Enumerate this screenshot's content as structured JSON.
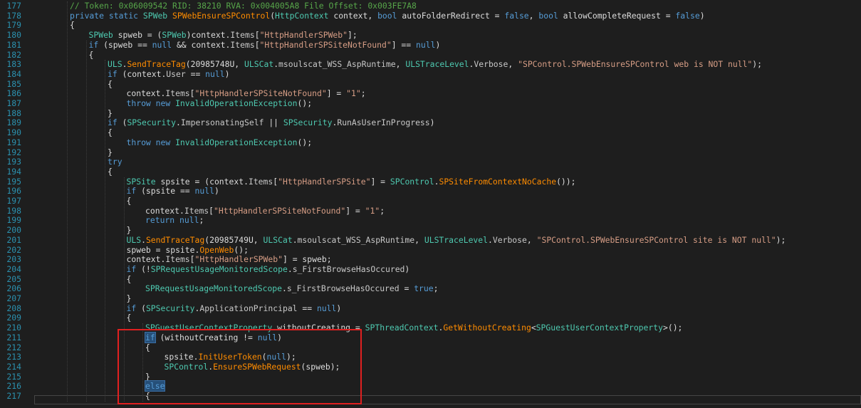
{
  "editor": {
    "lines": [
      {
        "n": "177",
        "indent": 2,
        "tokens": [
          {
            "c": "c",
            "t": "// Token: 0x06009542 RID: 38210 RVA: 0x004005A8 File Offset: 0x003FE7A8"
          }
        ]
      },
      {
        "n": "178",
        "indent": 2,
        "tokens": [
          {
            "c": "k",
            "t": "private static "
          },
          {
            "c": "t",
            "t": "SPWeb "
          },
          {
            "c": "m",
            "t": "SPWebEnsureSPControl"
          },
          {
            "c": "n",
            "t": "("
          },
          {
            "c": "t",
            "t": "HttpContext"
          },
          {
            "c": "n",
            "t": " context, "
          },
          {
            "c": "k",
            "t": "bool"
          },
          {
            "c": "n",
            "t": " autoFolderRedirect = "
          },
          {
            "c": "k",
            "t": "false"
          },
          {
            "c": "n",
            "t": ", "
          },
          {
            "c": "k",
            "t": "bool"
          },
          {
            "c": "n",
            "t": " allowCompleteRequest = "
          },
          {
            "c": "k",
            "t": "false"
          },
          {
            "c": "n",
            "t": ")"
          }
        ]
      },
      {
        "n": "179",
        "indent": 2,
        "tokens": [
          {
            "c": "n",
            "t": "{"
          }
        ]
      },
      {
        "n": "180",
        "indent": 3,
        "tokens": [
          {
            "c": "t",
            "t": "SPWeb"
          },
          {
            "c": "n",
            "t": " spweb = ("
          },
          {
            "c": "t",
            "t": "SPWeb"
          },
          {
            "c": "n",
            "t": ")context."
          },
          {
            "c": "p",
            "t": "Items"
          },
          {
            "c": "n",
            "t": "["
          },
          {
            "c": "s",
            "t": "\"HttpHandlerSPWeb\""
          },
          {
            "c": "n",
            "t": "];"
          }
        ]
      },
      {
        "n": "181",
        "indent": 3,
        "tokens": [
          {
            "c": "k",
            "t": "if"
          },
          {
            "c": "n",
            "t": " (spweb == "
          },
          {
            "c": "k",
            "t": "null"
          },
          {
            "c": "n",
            "t": " && context."
          },
          {
            "c": "p",
            "t": "Items"
          },
          {
            "c": "n",
            "t": "["
          },
          {
            "c": "s",
            "t": "\"HttpHandlerSPSiteNotFound\""
          },
          {
            "c": "n",
            "t": "] == "
          },
          {
            "c": "k",
            "t": "null"
          },
          {
            "c": "n",
            "t": ")"
          }
        ]
      },
      {
        "n": "182",
        "indent": 3,
        "tokens": [
          {
            "c": "n",
            "t": "{"
          }
        ]
      },
      {
        "n": "183",
        "indent": 4,
        "tokens": [
          {
            "c": "t",
            "t": "ULS"
          },
          {
            "c": "n",
            "t": "."
          },
          {
            "c": "m",
            "t": "SendTraceTag"
          },
          {
            "c": "n",
            "t": "(20985748U, "
          },
          {
            "c": "t",
            "t": "ULSCat"
          },
          {
            "c": "n",
            "t": "."
          },
          {
            "c": "p",
            "t": "msoulscat_WSS_AspRuntime"
          },
          {
            "c": "n",
            "t": ", "
          },
          {
            "c": "t",
            "t": "ULSTraceLevel"
          },
          {
            "c": "n",
            "t": "."
          },
          {
            "c": "p",
            "t": "Verbose"
          },
          {
            "c": "n",
            "t": ", "
          },
          {
            "c": "s",
            "t": "\"SPControl.SPWebEnsureSPControl web is NOT null\""
          },
          {
            "c": "n",
            "t": ");"
          }
        ]
      },
      {
        "n": "184",
        "indent": 4,
        "tokens": [
          {
            "c": "k",
            "t": "if"
          },
          {
            "c": "n",
            "t": " (context."
          },
          {
            "c": "p",
            "t": "User"
          },
          {
            "c": "n",
            "t": " == "
          },
          {
            "c": "k",
            "t": "null"
          },
          {
            "c": "n",
            "t": ")"
          }
        ]
      },
      {
        "n": "185",
        "indent": 4,
        "tokens": [
          {
            "c": "n",
            "t": "{"
          }
        ]
      },
      {
        "n": "186",
        "indent": 5,
        "tokens": [
          {
            "c": "n",
            "t": "context."
          },
          {
            "c": "p",
            "t": "Items"
          },
          {
            "c": "n",
            "t": "["
          },
          {
            "c": "s",
            "t": "\"HttpHandlerSPSiteNotFound\""
          },
          {
            "c": "n",
            "t": "] = "
          },
          {
            "c": "s",
            "t": "\"1\""
          },
          {
            "c": "n",
            "t": ";"
          }
        ]
      },
      {
        "n": "187",
        "indent": 5,
        "tokens": [
          {
            "c": "k",
            "t": "throw new "
          },
          {
            "c": "t",
            "t": "InvalidOperationException"
          },
          {
            "c": "n",
            "t": "();"
          }
        ]
      },
      {
        "n": "188",
        "indent": 4,
        "tokens": [
          {
            "c": "n",
            "t": "}"
          }
        ]
      },
      {
        "n": "189",
        "indent": 4,
        "tokens": [
          {
            "c": "k",
            "t": "if"
          },
          {
            "c": "n",
            "t": " ("
          },
          {
            "c": "t",
            "t": "SPSecurity"
          },
          {
            "c": "n",
            "t": "."
          },
          {
            "c": "p",
            "t": "ImpersonatingSelf"
          },
          {
            "c": "n",
            "t": " || "
          },
          {
            "c": "t",
            "t": "SPSecurity"
          },
          {
            "c": "n",
            "t": "."
          },
          {
            "c": "p",
            "t": "RunAsUserInProgress"
          },
          {
            "c": "n",
            "t": ")"
          }
        ]
      },
      {
        "n": "190",
        "indent": 4,
        "tokens": [
          {
            "c": "n",
            "t": "{"
          }
        ]
      },
      {
        "n": "191",
        "indent": 5,
        "tokens": [
          {
            "c": "k",
            "t": "throw new "
          },
          {
            "c": "t",
            "t": "InvalidOperationException"
          },
          {
            "c": "n",
            "t": "();"
          }
        ]
      },
      {
        "n": "192",
        "indent": 4,
        "tokens": [
          {
            "c": "n",
            "t": "}"
          }
        ]
      },
      {
        "n": "193",
        "indent": 4,
        "tokens": [
          {
            "c": "k",
            "t": "try"
          }
        ]
      },
      {
        "n": "194",
        "indent": 4,
        "tokens": [
          {
            "c": "n",
            "t": "{"
          }
        ]
      },
      {
        "n": "195",
        "indent": 5,
        "tokens": [
          {
            "c": "t",
            "t": "SPSite"
          },
          {
            "c": "n",
            "t": " spsite = (context."
          },
          {
            "c": "p",
            "t": "Items"
          },
          {
            "c": "n",
            "t": "["
          },
          {
            "c": "s",
            "t": "\"HttpHandlerSPSite\""
          },
          {
            "c": "n",
            "t": "] = "
          },
          {
            "c": "t",
            "t": "SPControl"
          },
          {
            "c": "n",
            "t": "."
          },
          {
            "c": "m",
            "t": "SPSiteFromContextNoCache"
          },
          {
            "c": "n",
            "t": "());"
          }
        ]
      },
      {
        "n": "196",
        "indent": 5,
        "tokens": [
          {
            "c": "k",
            "t": "if"
          },
          {
            "c": "n",
            "t": " (spsite == "
          },
          {
            "c": "k",
            "t": "null"
          },
          {
            "c": "n",
            "t": ")"
          }
        ]
      },
      {
        "n": "197",
        "indent": 5,
        "tokens": [
          {
            "c": "n",
            "t": "{"
          }
        ]
      },
      {
        "n": "198",
        "indent": 6,
        "tokens": [
          {
            "c": "n",
            "t": "context."
          },
          {
            "c": "p",
            "t": "Items"
          },
          {
            "c": "n",
            "t": "["
          },
          {
            "c": "s",
            "t": "\"HttpHandlerSPSiteNotFound\""
          },
          {
            "c": "n",
            "t": "] = "
          },
          {
            "c": "s",
            "t": "\"1\""
          },
          {
            "c": "n",
            "t": ";"
          }
        ]
      },
      {
        "n": "199",
        "indent": 6,
        "tokens": [
          {
            "c": "k",
            "t": "return null"
          },
          {
            "c": "n",
            "t": ";"
          }
        ]
      },
      {
        "n": "200",
        "indent": 5,
        "tokens": [
          {
            "c": "n",
            "t": "}"
          }
        ]
      },
      {
        "n": "201",
        "indent": 5,
        "tokens": [
          {
            "c": "t",
            "t": "ULS"
          },
          {
            "c": "n",
            "t": "."
          },
          {
            "c": "m",
            "t": "SendTraceTag"
          },
          {
            "c": "n",
            "t": "(20985749U, "
          },
          {
            "c": "t",
            "t": "ULSCat"
          },
          {
            "c": "n",
            "t": "."
          },
          {
            "c": "p",
            "t": "msoulscat_WSS_AspRuntime"
          },
          {
            "c": "n",
            "t": ", "
          },
          {
            "c": "t",
            "t": "ULSTraceLevel"
          },
          {
            "c": "n",
            "t": "."
          },
          {
            "c": "p",
            "t": "Verbose"
          },
          {
            "c": "n",
            "t": ", "
          },
          {
            "c": "s",
            "t": "\"SPControl.SPWebEnsureSPControl site is NOT null\""
          },
          {
            "c": "n",
            "t": ");"
          }
        ]
      },
      {
        "n": "202",
        "indent": 5,
        "tokens": [
          {
            "c": "n",
            "t": "spweb = spsite."
          },
          {
            "c": "m",
            "t": "OpenWeb"
          },
          {
            "c": "n",
            "t": "();"
          }
        ]
      },
      {
        "n": "203",
        "indent": 5,
        "tokens": [
          {
            "c": "n",
            "t": "context."
          },
          {
            "c": "p",
            "t": "Items"
          },
          {
            "c": "n",
            "t": "["
          },
          {
            "c": "s",
            "t": "\"HttpHandlerSPWeb\""
          },
          {
            "c": "n",
            "t": "] = spweb;"
          }
        ]
      },
      {
        "n": "204",
        "indent": 5,
        "tokens": [
          {
            "c": "k",
            "t": "if"
          },
          {
            "c": "n",
            "t": " (!"
          },
          {
            "c": "t",
            "t": "SPRequestUsageMonitoredScope"
          },
          {
            "c": "n",
            "t": "."
          },
          {
            "c": "p",
            "t": "s_FirstBrowseHasOccured"
          },
          {
            "c": "n",
            "t": ")"
          }
        ]
      },
      {
        "n": "205",
        "indent": 5,
        "tokens": [
          {
            "c": "n",
            "t": "{"
          }
        ]
      },
      {
        "n": "206",
        "indent": 6,
        "tokens": [
          {
            "c": "t",
            "t": "SPRequestUsageMonitoredScope"
          },
          {
            "c": "n",
            "t": "."
          },
          {
            "c": "p",
            "t": "s_FirstBrowseHasOccured"
          },
          {
            "c": "n",
            "t": " = "
          },
          {
            "c": "k",
            "t": "true"
          },
          {
            "c": "n",
            "t": ";"
          }
        ]
      },
      {
        "n": "207",
        "indent": 5,
        "tokens": [
          {
            "c": "n",
            "t": "}"
          }
        ]
      },
      {
        "n": "208",
        "indent": 5,
        "tokens": [
          {
            "c": "k",
            "t": "if"
          },
          {
            "c": "n",
            "t": " ("
          },
          {
            "c": "t",
            "t": "SPSecurity"
          },
          {
            "c": "n",
            "t": "."
          },
          {
            "c": "p",
            "t": "ApplicationPrincipal"
          },
          {
            "c": "n",
            "t": " == "
          },
          {
            "c": "k",
            "t": "null"
          },
          {
            "c": "n",
            "t": ")"
          }
        ]
      },
      {
        "n": "209",
        "indent": 5,
        "tokens": [
          {
            "c": "n",
            "t": "{"
          }
        ]
      },
      {
        "n": "210",
        "indent": 6,
        "tokens": [
          {
            "c": "t",
            "t": "SPGuestUserContextProperty"
          },
          {
            "c": "n",
            "t": " withoutCreating = "
          },
          {
            "c": "t",
            "t": "SPThreadContext"
          },
          {
            "c": "n",
            "t": "."
          },
          {
            "c": "m",
            "t": "GetWithoutCreating"
          },
          {
            "c": "n",
            "t": "<"
          },
          {
            "c": "t",
            "t": "SPGuestUserContextProperty"
          },
          {
            "c": "n",
            "t": ">();"
          }
        ]
      },
      {
        "n": "211",
        "indent": 6,
        "tokens": [
          {
            "c": "k",
            "t": "if",
            "hl": true
          },
          {
            "c": "n",
            "t": " (withoutCreating != "
          },
          {
            "c": "k",
            "t": "null"
          },
          {
            "c": "n",
            "t": ")"
          }
        ]
      },
      {
        "n": "212",
        "indent": 6,
        "tokens": [
          {
            "c": "n",
            "t": "{"
          }
        ]
      },
      {
        "n": "213",
        "indent": 7,
        "tokens": [
          {
            "c": "n",
            "t": "spsite."
          },
          {
            "c": "m",
            "t": "InitUserToken"
          },
          {
            "c": "n",
            "t": "("
          },
          {
            "c": "k",
            "t": "null"
          },
          {
            "c": "n",
            "t": ");"
          }
        ]
      },
      {
        "n": "214",
        "indent": 7,
        "tokens": [
          {
            "c": "t",
            "t": "SPControl"
          },
          {
            "c": "n",
            "t": "."
          },
          {
            "c": "m",
            "t": "EnsureSPWebRequest"
          },
          {
            "c": "n",
            "t": "(spweb);"
          }
        ]
      },
      {
        "n": "215",
        "indent": 6,
        "tokens": [
          {
            "c": "n",
            "t": "}"
          }
        ]
      },
      {
        "n": "216",
        "indent": 6,
        "tokens": [
          {
            "c": "k",
            "t": "else",
            "hl": true
          }
        ]
      },
      {
        "n": "217",
        "indent": 6,
        "tokens": [
          {
            "c": "n",
            "t": "{"
          }
        ]
      }
    ]
  }
}
